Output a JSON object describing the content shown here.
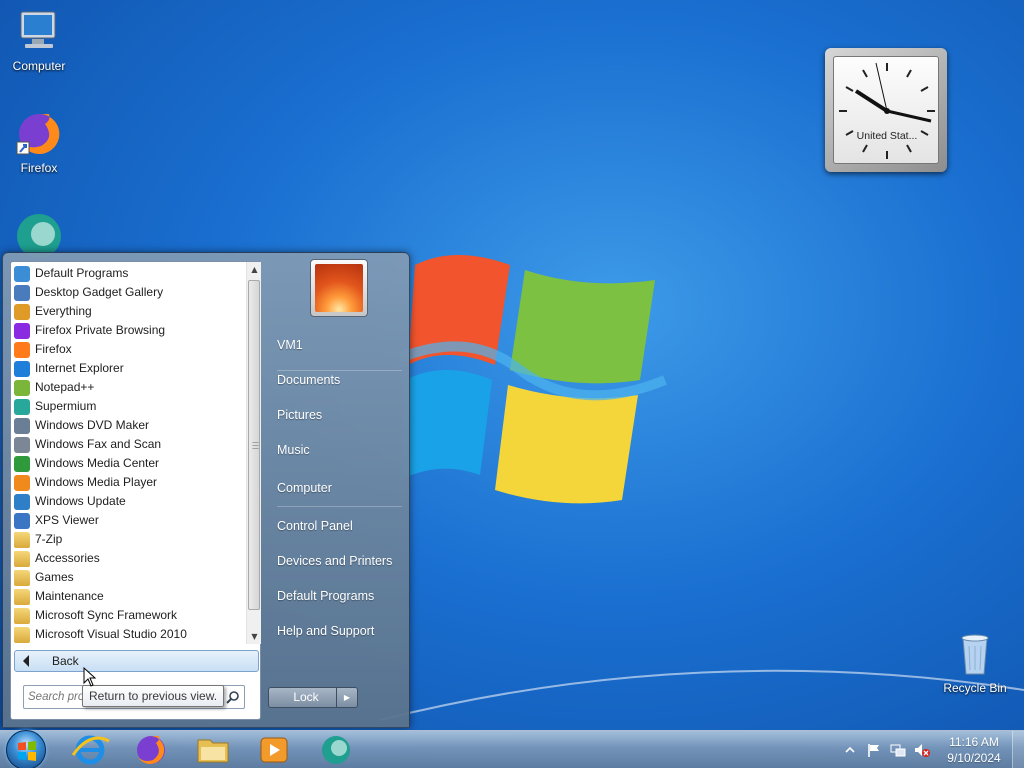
{
  "desktop": {
    "icons": [
      {
        "label": "Computer",
        "icon": "computer-icon"
      },
      {
        "label": "Firefox",
        "icon": "firefox-icon"
      },
      {
        "label": "",
        "icon": "supermium-icon"
      },
      {
        "label": "Recycle Bin",
        "icon": "recycle-bin-icon"
      }
    ]
  },
  "gadget": {
    "city": "United Stat..."
  },
  "start_menu": {
    "programs": [
      {
        "label": "Default Programs",
        "icon": "default-programs-icon",
        "color": "#3b8ed6"
      },
      {
        "label": "Desktop Gadget Gallery",
        "icon": "gadget-gallery-icon",
        "color": "#4a7bbd"
      },
      {
        "label": "Everything",
        "icon": "magnifier-icon",
        "color": "#e09a28"
      },
      {
        "label": "Firefox Private Browsing",
        "icon": "firefox-private-icon",
        "color": "#8a2be2"
      },
      {
        "label": "Firefox",
        "icon": "firefox-icon",
        "color": "#ff7a1a"
      },
      {
        "label": "Internet Explorer",
        "icon": "internet-explorer-icon",
        "color": "#1e7ed9"
      },
      {
        "label": "Notepad++",
        "icon": "notepadpp-icon",
        "color": "#7bb53a"
      },
      {
        "label": "Supermium",
        "icon": "supermium-icon",
        "color": "#27a89a"
      },
      {
        "label": "Windows DVD Maker",
        "icon": "dvd-maker-icon",
        "color": "#6a7f96"
      },
      {
        "label": "Windows Fax and Scan",
        "icon": "fax-scan-icon",
        "color": "#7b8794"
      },
      {
        "label": "Windows Media Center",
        "icon": "media-center-icon",
        "color": "#2f9a3c"
      },
      {
        "label": "Windows Media Player",
        "icon": "media-player-icon",
        "color": "#f08a1c"
      },
      {
        "label": "Windows Update",
        "icon": "windows-update-icon",
        "color": "#2f7fc8"
      },
      {
        "label": "XPS Viewer",
        "icon": "xps-viewer-icon",
        "color": "#3a76c4"
      },
      {
        "label": "7-Zip",
        "icon": "folder-icon",
        "color": "#e4b84a"
      },
      {
        "label": "Accessories",
        "icon": "folder-icon",
        "color": "#e4b84a"
      },
      {
        "label": "Games",
        "icon": "folder-icon",
        "color": "#e4b84a"
      },
      {
        "label": "Maintenance",
        "icon": "folder-icon",
        "color": "#e4b84a"
      },
      {
        "label": "Microsoft Sync Framework",
        "icon": "folder-icon",
        "color": "#e4b84a"
      },
      {
        "label": "Microsoft Visual Studio 2010",
        "icon": "folder-icon",
        "color": "#e4b84a"
      }
    ],
    "back_label": "Back",
    "search_placeholder": "Search programs and files",
    "tooltip": "Return to previous view.",
    "right_items": [
      {
        "label": "VM1",
        "name": "start-item-vm1"
      },
      {
        "label": "Documents",
        "name": "start-item-documents"
      },
      {
        "label": "Pictures",
        "name": "start-item-pictures"
      },
      {
        "label": "Music",
        "name": "start-item-music"
      },
      {
        "label": "Computer",
        "name": "start-item-computer"
      },
      {
        "label": "Control Panel",
        "name": "start-item-control-panel"
      },
      {
        "label": "Devices and Printers",
        "name": "start-item-devices-printers"
      },
      {
        "label": "Default Programs",
        "name": "start-item-default-programs"
      },
      {
        "label": "Help and Support",
        "name": "start-item-help-support"
      }
    ],
    "lock_label": "Lock"
  },
  "taskbar": {
    "apps": [
      "internet-explorer-icon",
      "firefox-icon",
      "file-explorer-icon",
      "media-player-icon",
      "supermium-icon"
    ],
    "time": "11:16 AM",
    "date": "9/10/2024"
  }
}
